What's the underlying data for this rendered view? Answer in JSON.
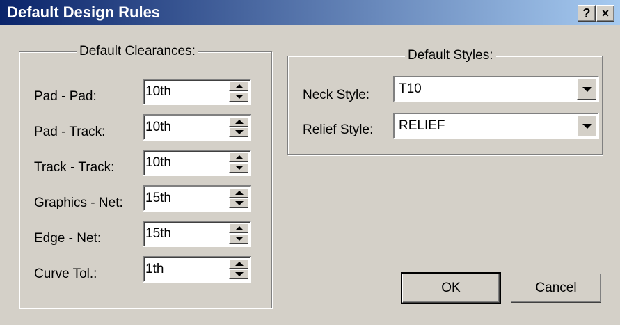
{
  "window": {
    "title": "Default Design Rules",
    "help_button": "?",
    "close_button": "×"
  },
  "clearances": {
    "group_label": "Default Clearances:",
    "rows": [
      {
        "label": "Pad - Pad:",
        "value": "10th"
      },
      {
        "label": "Pad - Track:",
        "value": "10th"
      },
      {
        "label": "Track - Track:",
        "value": "10th"
      },
      {
        "label": "Graphics - Net:",
        "value": "15th"
      },
      {
        "label": "Edge - Net:",
        "value": "15th"
      },
      {
        "label": "Curve Tol.:",
        "value": "1th"
      }
    ]
  },
  "styles": {
    "group_label": "Default Styles:",
    "neck_label": "Neck Style:",
    "neck_value": "T10",
    "relief_label": "Relief Style:",
    "relief_value": "RELIEF"
  },
  "buttons": {
    "ok": "OK",
    "cancel": "Cancel"
  }
}
